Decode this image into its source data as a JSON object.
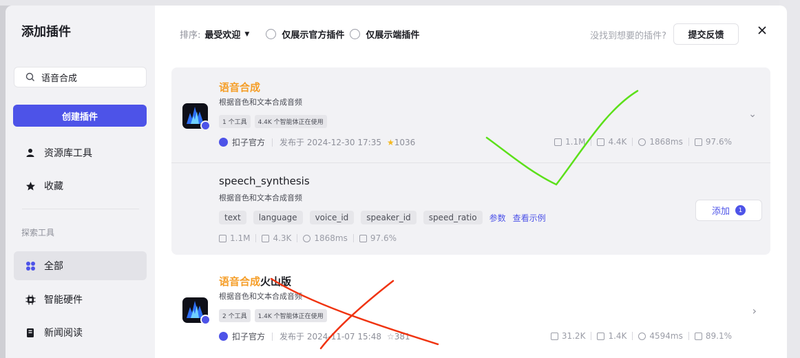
{
  "sidebar": {
    "title": "添加插件",
    "search_value": "语音合成",
    "create_button": "创建插件",
    "items": [
      {
        "label": "资源库工具",
        "icon": "user-icon"
      },
      {
        "label": "收藏",
        "icon": "star-icon"
      }
    ],
    "section_label": "探索工具",
    "categories": [
      {
        "label": "全部",
        "icon": "grid-icon",
        "active": true
      },
      {
        "label": "智能硬件",
        "icon": "chip-icon"
      },
      {
        "label": "新闻阅读",
        "icon": "news-icon"
      }
    ]
  },
  "toolbar": {
    "sort_label": "排序:",
    "sort_value": "最受欢迎",
    "filter_official": "仅展示官方插件",
    "filter_client": "仅展示端插件",
    "not_found_text": "没找到想要的插件?",
    "feedback_button": "提交反馈"
  },
  "plugins": [
    {
      "title": "语音合成",
      "title_suffix": "",
      "desc": "根据音色和文本合成音频",
      "tags": [
        "1 个工具",
        "4.4K 个智能体正在使用"
      ],
      "author": "扣子官方",
      "published": "发布于 2024-12-30 17:35",
      "stars": "1036",
      "stats": [
        "1.1M",
        "4.4K",
        "1868ms",
        "97.6%"
      ],
      "expanded": true,
      "tool": {
        "name": "speech_synthesis",
        "desc": "根据音色和文本合成音频",
        "params": [
          "text",
          "language",
          "voice_id",
          "speaker_id",
          "speed_ratio"
        ],
        "params_link": "参数",
        "example_link": "查看示例",
        "stats": [
          "1.1M",
          "4.3K",
          "1868ms",
          "97.6%"
        ],
        "add_label": "添加",
        "add_count": "1"
      }
    },
    {
      "title": "语音合成",
      "title_suffix": "火山版",
      "desc": "根据音色和文本合成音频",
      "tags": [
        "2 个工具",
        "1.4K 个智能体正在使用"
      ],
      "author": "扣子官方",
      "published": "发布于 2024-11-07 15:48",
      "stars": "381",
      "stats": [
        "31.2K",
        "1.4K",
        "4594ms",
        "89.1%"
      ],
      "expanded": false
    }
  ],
  "colors": {
    "accent": "#4d53e8",
    "highlight": "#f59e28",
    "check_mark": "#5ce01a",
    "cross_mark": "#f0330f"
  }
}
